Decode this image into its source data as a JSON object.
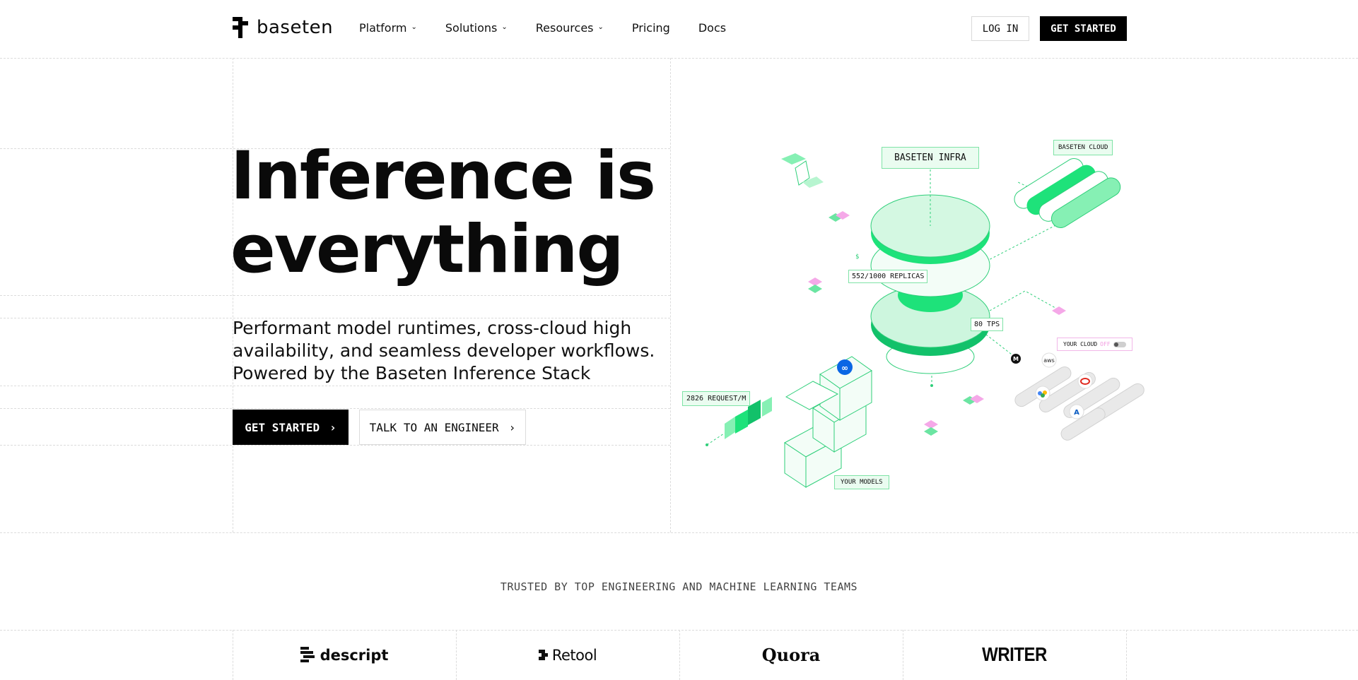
{
  "header": {
    "brand": "baseten",
    "nav": [
      {
        "label": "Platform",
        "has_menu": true
      },
      {
        "label": "Solutions",
        "has_menu": true
      },
      {
        "label": "Resources",
        "has_menu": true
      },
      {
        "label": "Pricing",
        "has_menu": false
      },
      {
        "label": "Docs",
        "has_menu": false
      }
    ],
    "login_label": "LOG IN",
    "get_started_label": "GET STARTED"
  },
  "hero": {
    "title_line1": "Inference is",
    "title_line2": "everything",
    "subtitle_line1": "Performant model runtimes, cross-cloud high",
    "subtitle_line2": "availability, and seamless developer workflows.",
    "subtitle_line3": "Powered by the Baseten Inference Stack",
    "cta_primary": "GET STARTED",
    "cta_secondary": "TALK TO AN ENGINEER"
  },
  "illustration": {
    "infra_label": "BASETEN INFRA",
    "cloud_label": "BASETEN CLOUD",
    "replicas_label": "552/1000 REPLICAS",
    "tps_label": "80 TPS",
    "requests_label": "2826 REQUEST/M",
    "your_cloud_label": "YOUR CLOUD",
    "your_cloud_state": "OFF",
    "your_models_label": "YOUR MODELS",
    "dollar_label": "$",
    "aws_label": "aws",
    "mistral_label": "M",
    "azure_label": "A"
  },
  "trusted": {
    "heading": "TRUSTED BY TOP ENGINEERING AND MACHINE LEARNING TEAMS",
    "logos": [
      "descript",
      "Retool",
      "Quora",
      "WRITER"
    ]
  },
  "colors": {
    "green": "#22e07a",
    "mint": "#d4f8e2",
    "pink": "#f5a8e8",
    "black": "#000000"
  }
}
